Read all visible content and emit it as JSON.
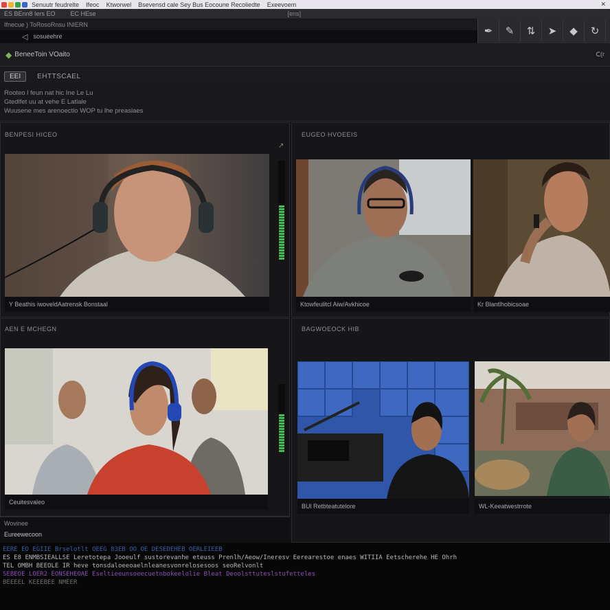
{
  "browser": {
    "tabs": [
      "Senuutr feudrelte",
      "Ifeoc",
      "Ktworwel",
      "Bsevensd cale Sey Bus Eocoune Recoliedte",
      "Exeevoem"
    ],
    "fav_colors": [
      "#e0463a",
      "#f2b233",
      "#3d9f4c",
      "#3866c9"
    ],
    "close_glyph": "✕"
  },
  "menubar": {
    "menu_items": [
      "ES BEnn8 Iers EO",
      "EC HEse"
    ],
    "extra": "[ens]"
  },
  "addressbar": {
    "path": "Ifnecue ) ToRosoRnsu INIERN"
  },
  "urlbar": {
    "back": "◁",
    "text": "sosueehre"
  },
  "toolbox": {
    "tools": [
      {
        "name": "brush-icon",
        "glyph": "✒"
      },
      {
        "name": "pen-icon",
        "glyph": "✎"
      },
      {
        "name": "adjust-icon",
        "glyph": "⇅"
      },
      {
        "name": "arrow-icon",
        "glyph": "➤"
      },
      {
        "name": "diamond-icon",
        "glyph": "◆"
      },
      {
        "name": "refresh-icon",
        "glyph": "↻"
      }
    ]
  },
  "app": {
    "logo": "◆",
    "name": "BeneeToin VOaito",
    "help": "ᑕ(r",
    "action_button": "EEI",
    "action_label": "EHTTSCAEL",
    "description": [
      "Rooteo l feun nat hic Ine Le Lu",
      "Gtedlfet uu at vehe E Latlale",
      "Wuusene mes arenoectlo WOP tu lhe preaslaes"
    ]
  },
  "panels": {
    "p1": {
      "title": "BENPESI HICEO",
      "caption": "Y Beathis iwoveldAatrensk Bonstaal",
      "corner": "↗"
    },
    "p2": {
      "title": "EUGEO HVOEEIS",
      "captions": [
        "Ktowfeulitcl Aiw/Avkhicoe",
        "Kr Blantlhobicsoae"
      ]
    },
    "p3": {
      "title": "AEN E MCHEGN",
      "caption": "Ceuitesvaleo"
    },
    "p4": {
      "title": "BAGWOEOCK HIB",
      "captions": [
        "BUl Retbteatutelore",
        "WL-Keeatwestrrote"
      ]
    }
  },
  "meters": {
    "p1_level": 0.58,
    "p3_level": 0.6
  },
  "status": {
    "line1": "Wovinee",
    "line2": "Eureewecoon"
  },
  "console": [
    {
      "cls": "c1",
      "text": "EERE EO EGIIE Brselotlt OEEG 83EB OO OE DESEDEHEB OERLEIEEB"
    },
    {
      "cls": "c2",
      "text": "ES E8 ENMBSIEALLSE   Leretotepa Jooeulf sustorevanhe eteuss   Prenlh/Aeow/Ineresv   Eerearestoe enaes WITIIA Eetscherehe HE Ohrh"
    },
    {
      "cls": "c2",
      "text": "TEL OMBH BEEOLE   IR heve tonsdaloeeoaelnleanesvonrelosesoos seoRelvonlt"
    },
    {
      "cls": "c3",
      "text": "SEBEOE LOER2 EONSEHEOAE   Eseltieeunsoeecuetnbokeelolie Bleat Deoolsttuteslstufetteles"
    },
    {
      "cls": "c4",
      "text": "BEEEEL KEEEBEE NMEER"
    }
  ]
}
